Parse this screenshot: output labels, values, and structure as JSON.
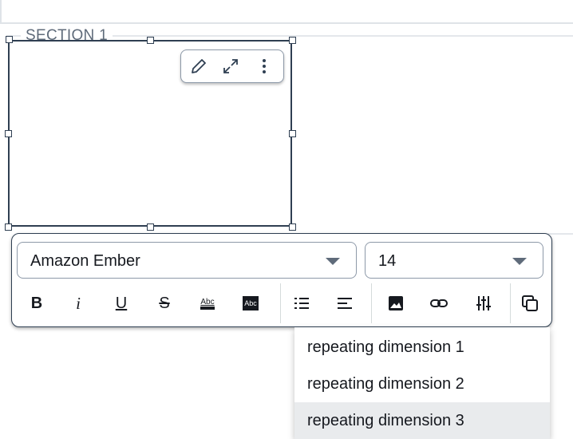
{
  "section": {
    "title": "SECTION 1"
  },
  "mini_toolbar": {
    "icons": [
      "pencil-icon",
      "expand-icon",
      "more-vertical-icon"
    ]
  },
  "format_toolbar": {
    "font_family": "Amazon Ember",
    "font_size": "14",
    "buttons": [
      "bold",
      "italic",
      "underline",
      "strikethrough",
      "text-color",
      "highlight-color",
      "bulleted-list",
      "align-left",
      "insert-image",
      "insert-link",
      "insert-parameter",
      "copy"
    ],
    "bold_label": "B",
    "italic_label": "i",
    "underline_label": "U",
    "strike_label": "S",
    "text_color_label": "Abc",
    "highlight_label": "Abc"
  },
  "dropdown": {
    "items": [
      {
        "label": "repeating dimension 1"
      },
      {
        "label": "repeating dimension 2"
      },
      {
        "label": "repeating dimension 3"
      }
    ],
    "active_index": 2
  },
  "colors": {
    "selection_border": "#2f3f52",
    "divider": "#e4e7eb",
    "active_item_bg": "#e9ebed"
  }
}
